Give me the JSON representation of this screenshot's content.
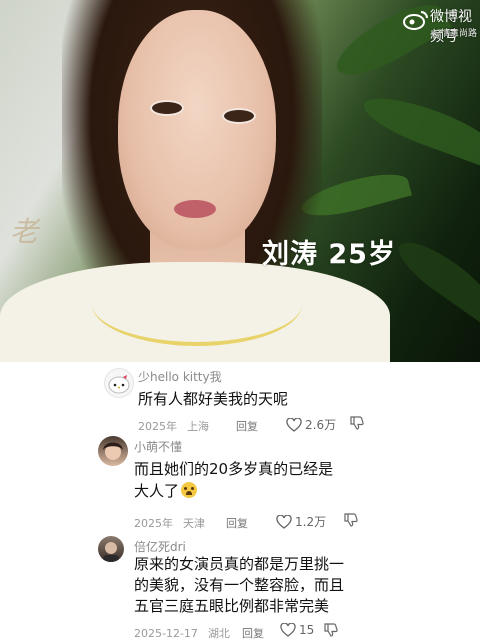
{
  "video": {
    "caption": "刘涛 25岁",
    "watermark": "微博视频号",
    "watermark_sub": "@情意尚路"
  },
  "comments": [
    {
      "username": "少hello kitty我",
      "text_lines": [
        "所有人都好美我的天呢"
      ],
      "year": "2025年",
      "location": "上海",
      "reply_label": "回复",
      "likes": "2.6万"
    },
    {
      "username": "小萌不懂",
      "text_lines": [
        "而且她们的20多岁真的已经是",
        "大人了"
      ],
      "year": "2025年",
      "location": "天津",
      "reply_label": "回复",
      "likes": "1.2万"
    },
    {
      "username": "倍亿死dri",
      "text_lines": [
        "原来的女演员真的都是万里挑一",
        "的美貌，没有一个整容脸，而且",
        "五官三庭五眼比例都非常完美"
      ],
      "year": "2025-12-17",
      "location": "湖北",
      "reply_label": "回复",
      "likes": "15"
    }
  ]
}
